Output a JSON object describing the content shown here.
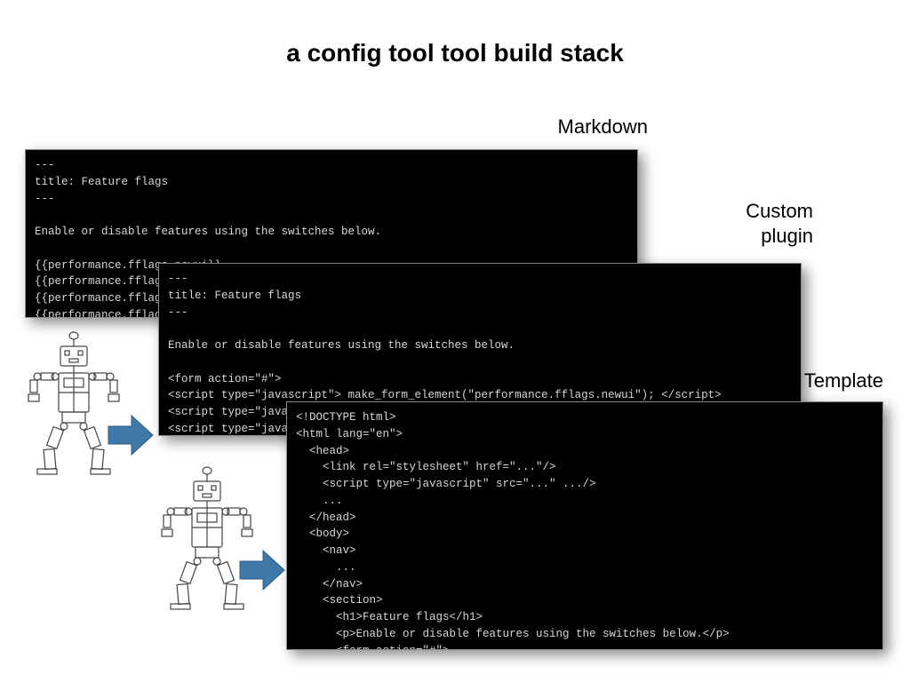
{
  "title": "a config tool tool build stack",
  "labels": {
    "markdown": "Markdown",
    "plugin": "Custom\nplugin",
    "template": "Template"
  },
  "code": {
    "markdown": "---\ntitle: Feature flags\n---\n\nEnable or disable features using the switches below.\n\n{{performance.fflags.newui}}\n{{performance.fflags.wall}}\n{{performance.fflags▓▓▓▓▓▓▓▓▓▓▓▓▓▓▓▓▓▓\n{{performance.fflags▓▓▓▓▓▓▓▓▓▓▓▓▓▓▓▓▓▓\n...",
    "plugin": "---\ntitle: Feature flags\n---\n\nEnable or disable features using the switches below.\n\n<form action=\"#\">\n<script type=\"javascript\"> make_form_element(\"performance.fflags.newui\"); </script>\n<script type=\"javascript\"> make_form_element(\"performance.fflags.wall\"); </script>\n<script type=\"javascript\"> make_form_element(\"performance.fflags.profile_service\"); </script>\n<script type=\"jav▓▓▓▓▓▓▓▓▓▓▓▓▓▓▓▓▓▓▓▓▓▓▓▓▓▓▓▓▓▓▓▓▓▓▓▓▓▓▓▓▓▓▓▓▓▓▓▓▓▓▓▓▓▓▓▓▓▓▓▓▓▓▓▓\n</form>\n...",
    "template": "<!DOCTYPE html>\n<html lang=\"en\">\n  <head>\n    <link rel=\"stylesheet\" href=\"...\"/>\n    <script type=\"javascript\" src=\"...\" .../>\n    ...\n  </head>\n  <body>\n    <nav>\n      ...\n    </nav>\n    <section>\n      <h1>Feature flags</h1>\n      <p>Enable or disable features using the switches below.</p>\n      <form action=\"#\">\n      <script type=\"javascript\"> make_form_element(\"performance.fflags.newui\"); </script>\n      ..."
  }
}
